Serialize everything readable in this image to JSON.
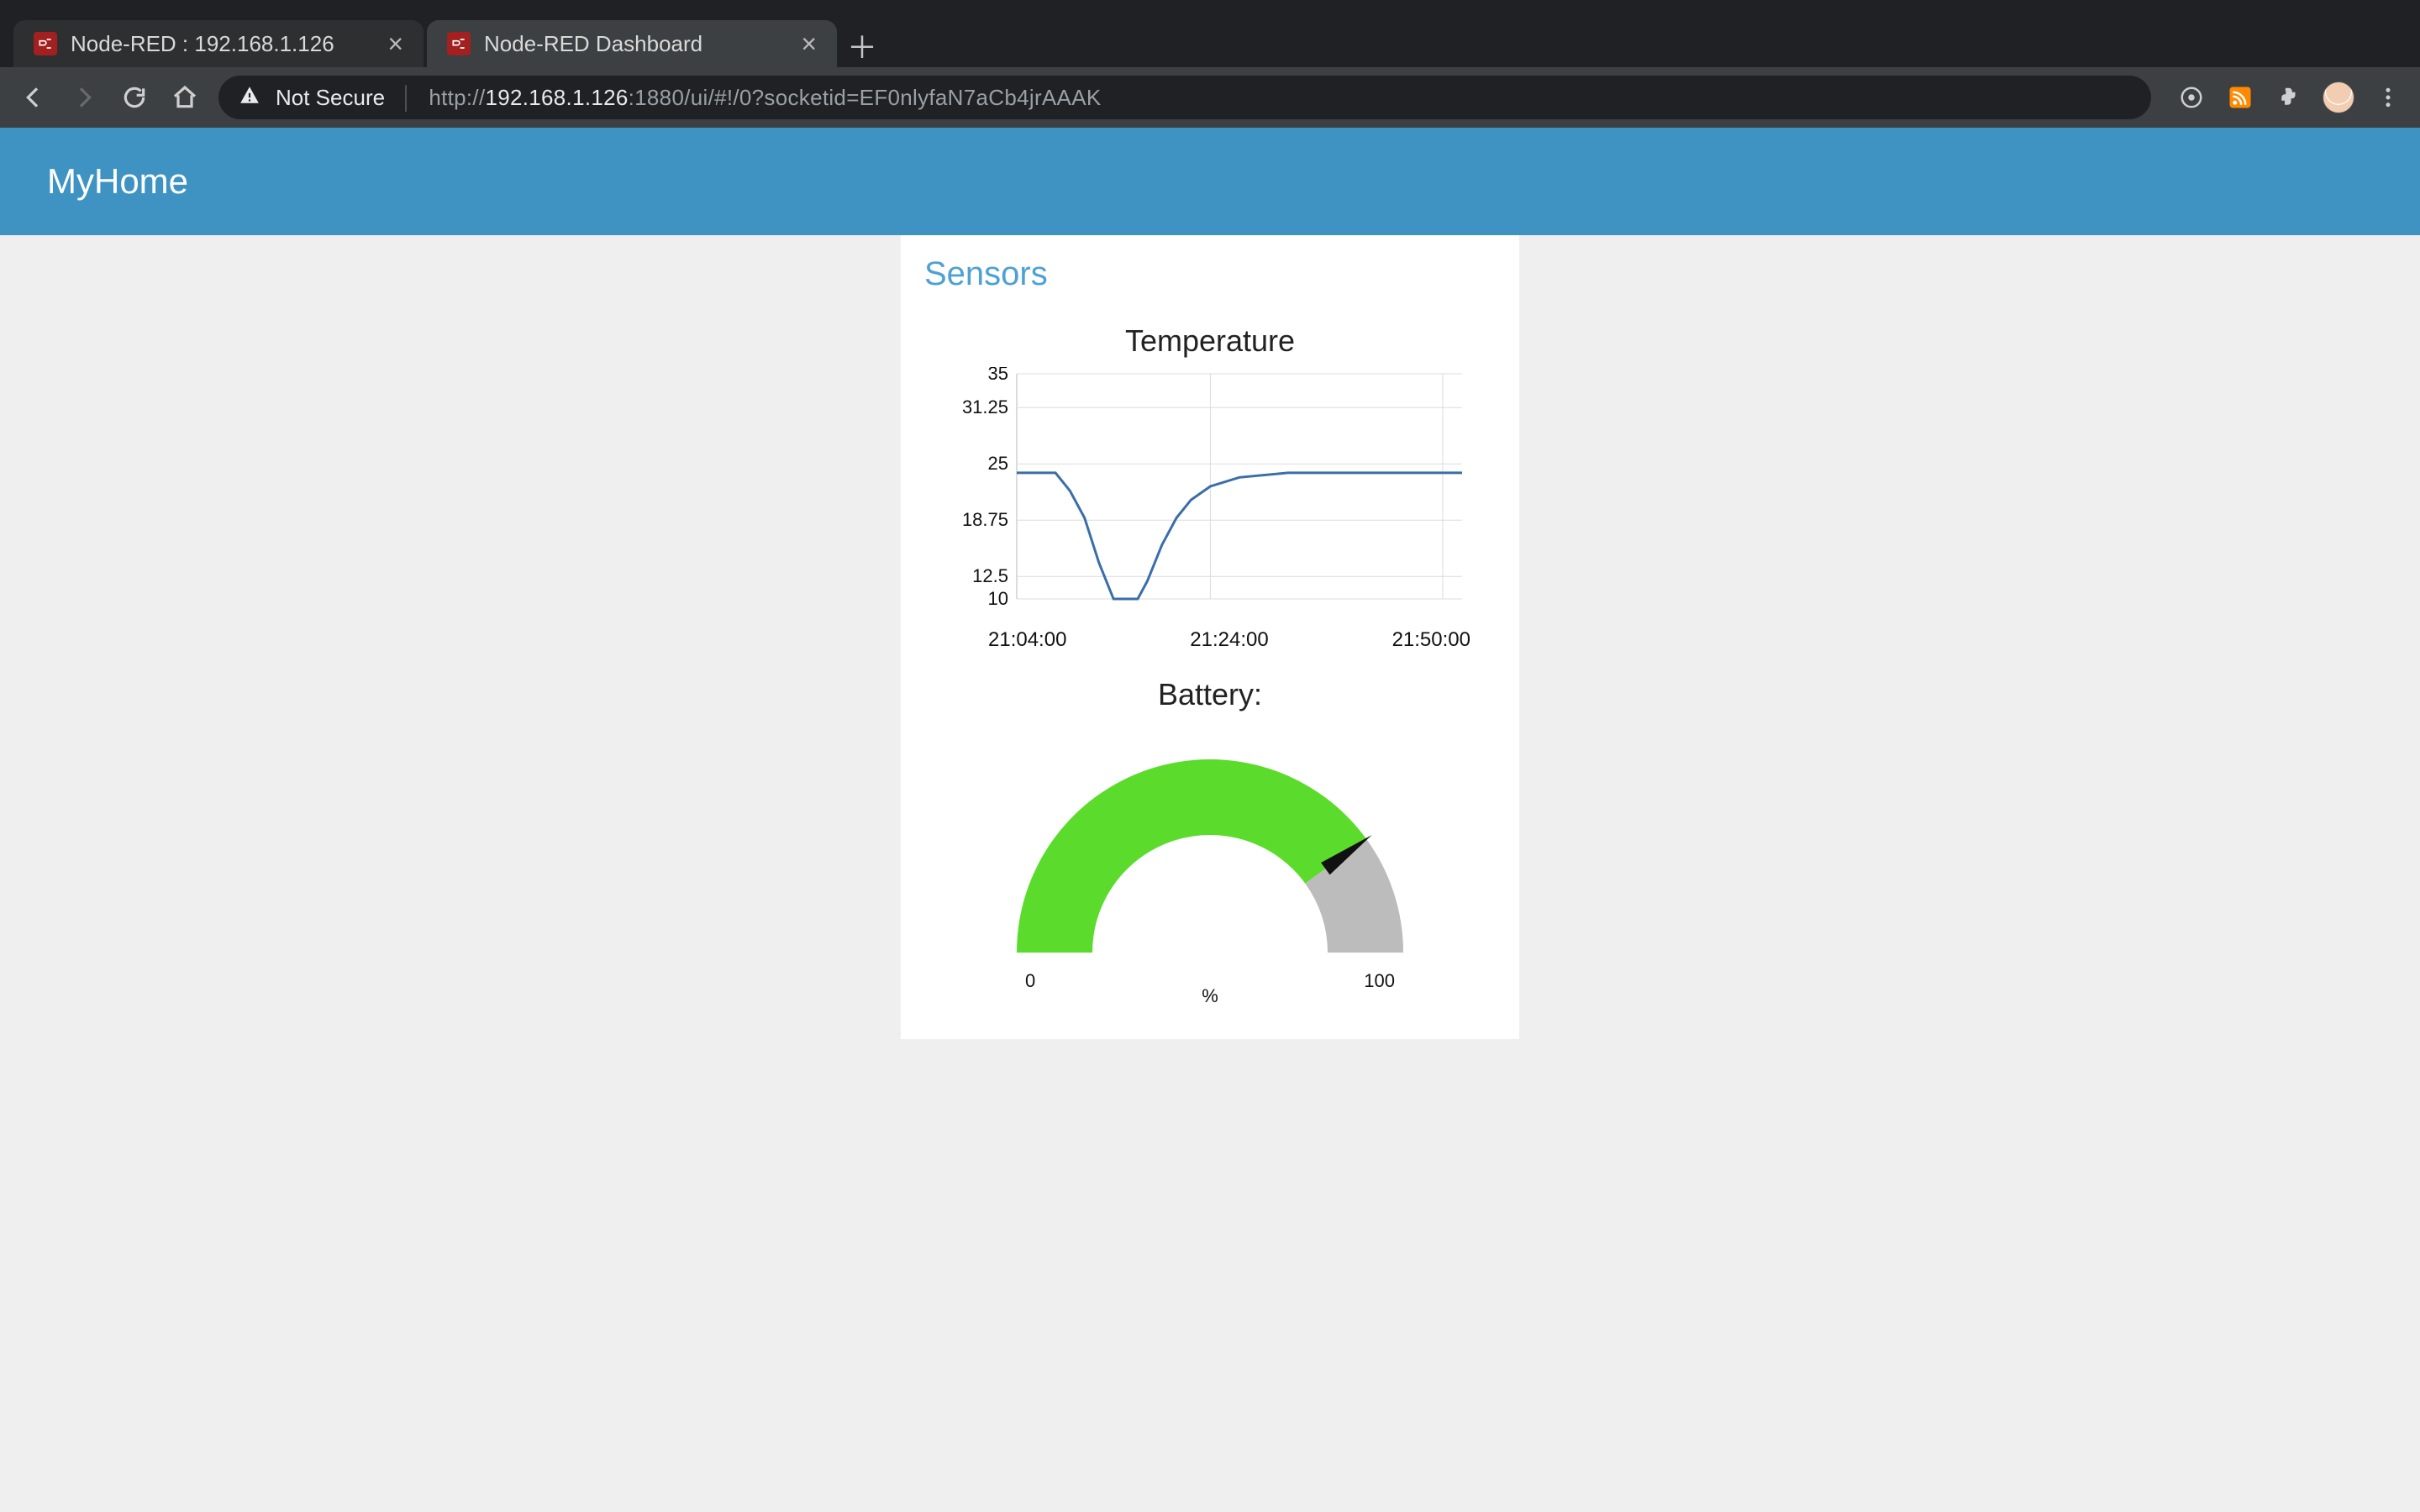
{
  "browser": {
    "tabs": [
      {
        "title": "Node-RED : 192.168.1.126",
        "active": false
      },
      {
        "title": "Node-RED Dashboard",
        "active": true
      }
    ],
    "not_secure_label": "Not Secure",
    "url": {
      "left": "http://",
      "mid": "192.168.1.126",
      "right": ":1880/ui/#!/0?socketid=EF0nlyfaN7aCb4jrAAAK"
    }
  },
  "app": {
    "header_title": "MyHome",
    "card_title": "Sensors"
  },
  "temperature_chart_title": "Temperature",
  "battery_title": "Battery:",
  "gauge": {
    "min_label": "0",
    "max_label": "100",
    "unit_label": "%"
  },
  "chart_data": [
    {
      "type": "line",
      "title": "Temperature",
      "xlabel": "",
      "ylabel": "",
      "ylim": [
        10,
        35
      ],
      "x_tick_labels": [
        "21:04:00",
        "21:24:00",
        "21:50:00"
      ],
      "y_tick_labels": [
        "35",
        "31.25",
        "25",
        "18.75",
        "12.5",
        "10"
      ],
      "series": [
        {
          "name": "Temperature",
          "points": [
            {
              "x": "21:04:00",
              "y": 24
            },
            {
              "x": "21:06:30",
              "y": 24
            },
            {
              "x": "21:08:00",
              "y": 24
            },
            {
              "x": "21:09:30",
              "y": 22
            },
            {
              "x": "21:11:00",
              "y": 19
            },
            {
              "x": "21:12:30",
              "y": 14
            },
            {
              "x": "21:14:00",
              "y": 10
            },
            {
              "x": "21:15:00",
              "y": 10
            },
            {
              "x": "21:16:30",
              "y": 10
            },
            {
              "x": "21:17:30",
              "y": 12
            },
            {
              "x": "21:19:00",
              "y": 16
            },
            {
              "x": "21:20:30",
              "y": 19
            },
            {
              "x": "21:22:00",
              "y": 21
            },
            {
              "x": "21:24:00",
              "y": 22.5
            },
            {
              "x": "21:27:00",
              "y": 23.5
            },
            {
              "x": "21:32:00",
              "y": 24
            },
            {
              "x": "21:50:00",
              "y": 24
            }
          ]
        }
      ]
    },
    {
      "type": "gauge",
      "title": "Battery:",
      "min": 0,
      "max": 100,
      "value": 80,
      "unit": "%",
      "sectors": [
        {
          "from": 0,
          "to": 80,
          "color": "#5bdb2b"
        },
        {
          "from": 80,
          "to": 100,
          "color": "#bcbcbc"
        }
      ]
    }
  ]
}
